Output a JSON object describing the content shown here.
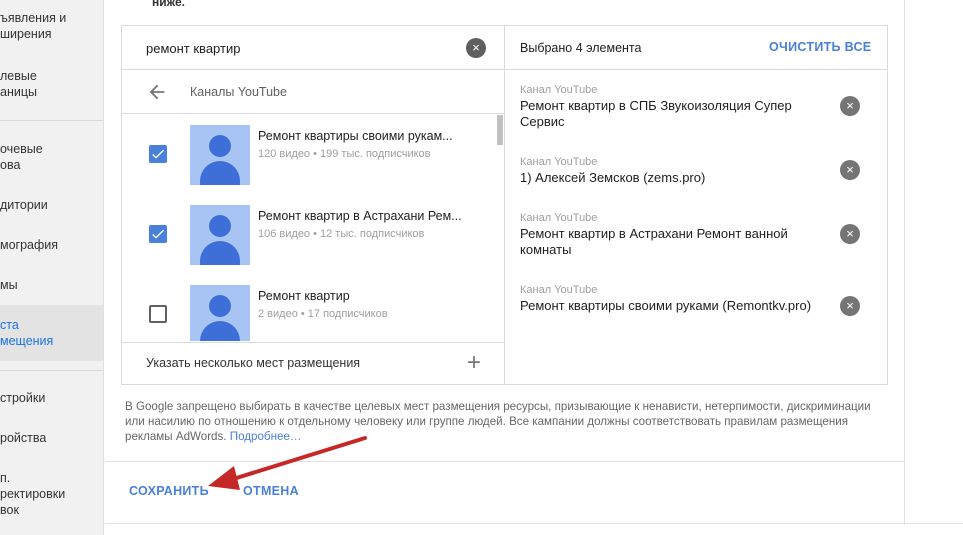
{
  "sidebar": {
    "items": [
      {
        "label": "ъявления и\nширения"
      },
      {
        "label": "левые\nаницы"
      },
      {
        "label": "очевые\nова"
      },
      {
        "label": "дитории"
      },
      {
        "label": "мография"
      },
      {
        "label": "мы"
      },
      {
        "label": "ста\nмещения"
      },
      {
        "label": "стройки"
      },
      {
        "label": "ройства"
      },
      {
        "label": "п.\nректировки\nвок"
      }
    ]
  },
  "top_note": "ниже.",
  "search": {
    "value": "ремонт квартир",
    "clear_icon": "×"
  },
  "breadcrumb": {
    "label": "Каналы YouTube"
  },
  "results": [
    {
      "title": "Ремонт квартиры своими рукам...",
      "meta": "120 видео • 199 тыс. подписчиков",
      "checked": true
    },
    {
      "title": "Ремонт квартир в Астрахани Рем...",
      "meta": "106 видео • 12 тыс. подписчиков",
      "checked": true
    },
    {
      "title": "Ремонт квартир",
      "meta": "2 видео • 17 подписчиков",
      "checked": false
    }
  ],
  "multi_placement": {
    "label": "Указать несколько мест размещения",
    "icon": "+"
  },
  "selected": {
    "count_label": "Выбрано 4 элемента",
    "clear_all": "ОЧИСТИТЬ ВСЕ",
    "items": [
      {
        "kind": "Канал YouTube",
        "name": "Ремонт квартир в СПБ Звукоизоляция Супер Сервис"
      },
      {
        "kind": "Канал YouTube",
        "name": "1) Алексей Земсков (zems.pro)"
      },
      {
        "kind": "Канал YouTube",
        "name": "Ремонт квартир в Астрахани Ремонт ванной комнаты"
      },
      {
        "kind": "Канал YouTube",
        "name": "Ремонт квартиры своими руками (Remontkv.pro)"
      }
    ],
    "remove_icon": "×"
  },
  "policy": {
    "text": "В Google запрещено выбирать в качестве целевых мест размещения ресурсы, призывающие к ненависти, нетерпимости, дискриминации или насилию по отношению к отдельному человеку или группе людей. Все кампании должны соответствовать правилам размещения рекламы AdWords. ",
    "link": "Подробнее…"
  },
  "actions": {
    "save": "СОХРАНИТЬ",
    "cancel": "ОТМЕНА"
  },
  "colors": {
    "accent": "#4a80d9",
    "annotation_arrow": "#c62828"
  }
}
